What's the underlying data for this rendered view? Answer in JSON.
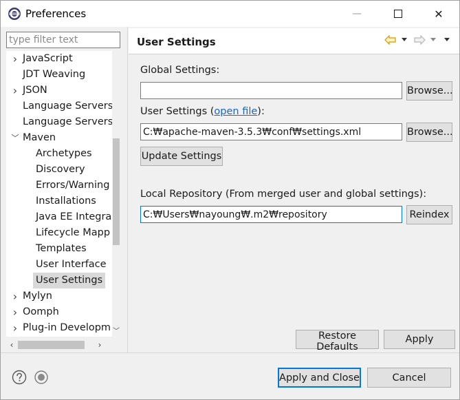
{
  "window": {
    "title": "Preferences",
    "minimize_glyph": "—",
    "close_glyph": "✕"
  },
  "filter": {
    "placeholder": "type filter text",
    "value": ""
  },
  "tree": {
    "items": [
      {
        "label": "JavaScript",
        "expandable": true,
        "indent": 0
      },
      {
        "label": "JDT Weaving",
        "expandable": false,
        "indent": 0
      },
      {
        "label": "JSON",
        "expandable": true,
        "indent": 0
      },
      {
        "label": "Language Servers",
        "expandable": false,
        "indent": 0
      },
      {
        "label": "Language Servers",
        "expandable": false,
        "indent": 0
      },
      {
        "label": "Maven",
        "expandable": true,
        "expanded": true,
        "indent": 0
      },
      {
        "label": "Archetypes",
        "expandable": false,
        "indent": 1
      },
      {
        "label": "Discovery",
        "expandable": false,
        "indent": 1
      },
      {
        "label": "Errors/Warning",
        "expandable": false,
        "indent": 1
      },
      {
        "label": "Installations",
        "expandable": false,
        "indent": 1
      },
      {
        "label": "Java EE Integra",
        "expandable": false,
        "indent": 1
      },
      {
        "label": "Lifecycle Mapp",
        "expandable": false,
        "indent": 1
      },
      {
        "label": "Templates",
        "expandable": false,
        "indent": 1
      },
      {
        "label": "User Interface",
        "expandable": false,
        "indent": 1
      },
      {
        "label": "User Settings",
        "expandable": false,
        "indent": 1,
        "selected": true
      },
      {
        "label": "Mylyn",
        "expandable": true,
        "indent": 0
      },
      {
        "label": "Oomph",
        "expandable": true,
        "indent": 0
      },
      {
        "label": "Plug-in Developm",
        "expandable": true,
        "indent": 0
      }
    ]
  },
  "page": {
    "title": "User Settings",
    "global_settings_label": "Global Settings:",
    "global_settings_value": "",
    "browse_label": "Browse...",
    "user_settings_prefix": "User Settings (",
    "open_file_link": "open file",
    "user_settings_suffix": "):",
    "user_settings_value": "C:₩apache-maven-3.5.3₩conf₩settings.xml",
    "update_settings_label": "Update Settings",
    "local_repo_label": "Local Repository (From merged user and global settings):",
    "local_repo_value": "C:₩Users₩nayoung₩.m2₩repository",
    "reindex_label": "Reindex",
    "restore_defaults_label": "Restore Defaults",
    "apply_label": "Apply"
  },
  "footer": {
    "apply_close_label": "Apply and Close",
    "cancel_label": "Cancel"
  },
  "colors": {
    "accent": "#0078d7",
    "link": "#1a66c4",
    "back_arrow": "#e0a100"
  }
}
